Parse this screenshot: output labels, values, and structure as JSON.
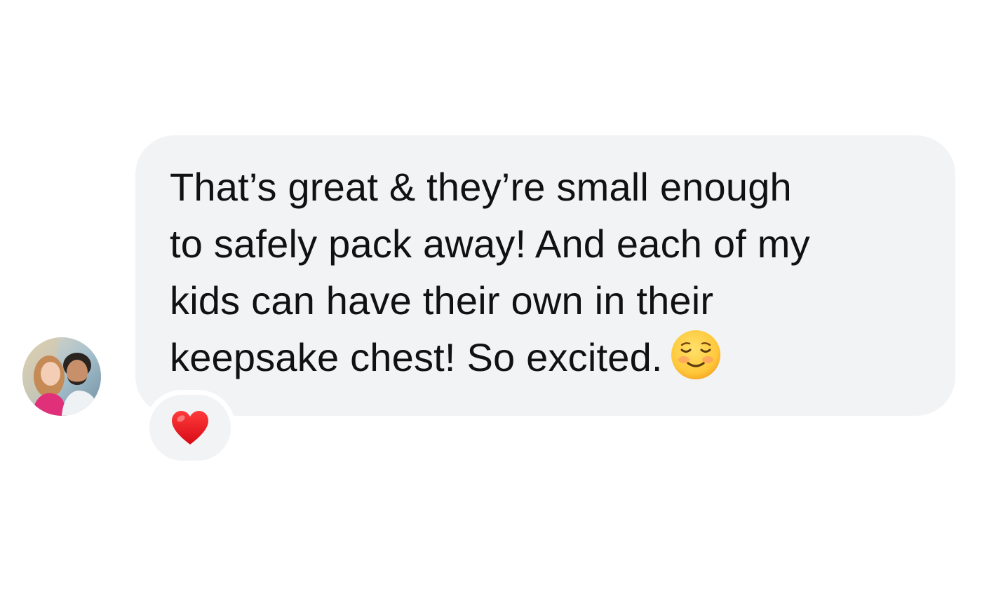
{
  "conversation": {
    "message": {
      "lines": [
        "That’s great & they’re small enough",
        "to safely pack away! And each of my",
        "kids can have their own in their",
        "keepsake chest! So excited."
      ],
      "emoji": "relieved-smiling-face-icon"
    },
    "reaction": {
      "icon": "red-heart-icon"
    },
    "avatar": {
      "icon": "profile-photo-avatar"
    }
  },
  "colors": {
    "bubble_background": "#f2f3f5",
    "text": "#111111",
    "heart": "#e0101c",
    "emoji_face": "#ffc83a"
  }
}
